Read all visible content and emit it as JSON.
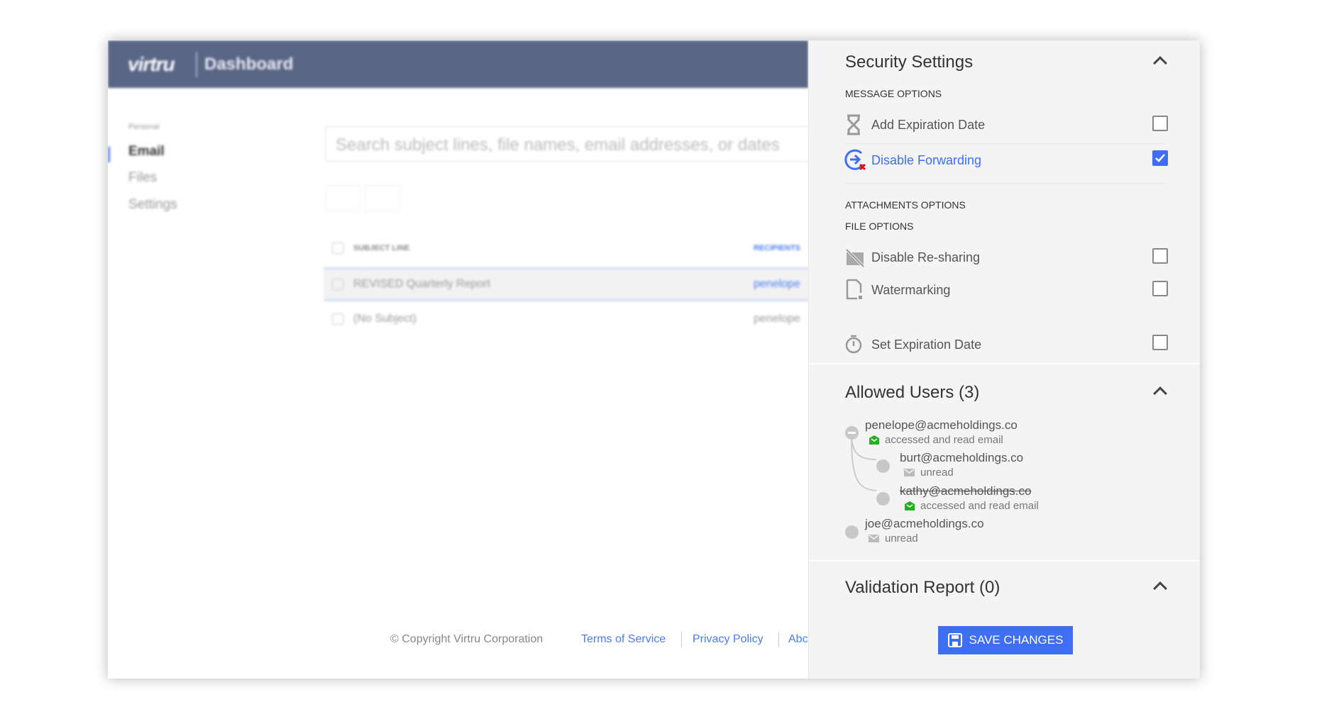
{
  "header": {
    "logo": "virtru",
    "title": "Dashboard"
  },
  "sidebar": {
    "section": "Personal",
    "items": [
      {
        "label": "Email",
        "active": true
      },
      {
        "label": "Files"
      },
      {
        "label": "Settings"
      }
    ]
  },
  "search": {
    "placeholder": "Search subject lines, file names, email addresses, or dates"
  },
  "table": {
    "columns": [
      "SUBJECT LINE",
      "RECIPIENTS"
    ],
    "rows": [
      {
        "subject": "REVISED Quarterly Report",
        "recipient": "penelope",
        "selected": true
      },
      {
        "subject": "(No Subject)",
        "recipient": "penelope"
      }
    ]
  },
  "footer": {
    "copyright": "© Copyright Virtru Corporation",
    "links": [
      "Terms of Service",
      "Privacy Policy",
      "Abc"
    ]
  },
  "panel": {
    "security": {
      "title": "Security Settings",
      "message_options": "MESSAGE OPTIONS",
      "attachments_options": "ATTACHMENTS OPTIONS",
      "file_options": "FILE OPTIONS",
      "options": [
        {
          "label": "Add Expiration Date",
          "icon": "hourglass-icon",
          "checked": false
        },
        {
          "label": "Disable Forwarding",
          "icon": "disable-forward-icon",
          "checked": true
        },
        {
          "label": "Disable Re-sharing",
          "icon": "no-share-icon",
          "checked": false
        },
        {
          "label": "Watermarking",
          "icon": "watermark-file-icon",
          "checked": false
        },
        {
          "label": "Set Expiration Date",
          "icon": "stopwatch-icon",
          "checked": false
        }
      ]
    },
    "allowed_users": {
      "title": "Allowed Users (3)",
      "users": [
        {
          "email": "penelope@acmeholdings.co",
          "status": "accessed and read email"
        },
        {
          "email": "burt@acmeholdings.co",
          "status": "unread"
        },
        {
          "email": "kathy@acmeholdings.co",
          "status": "accessed and read email",
          "revoked": true
        },
        {
          "email": "joe@acmeholdings.co",
          "status": "unread"
        }
      ]
    },
    "validation": {
      "title": "Validation Report (0)"
    },
    "save_label": "SAVE CHANGES"
  },
  "colors": {
    "header": "#5a6686",
    "accent": "#3d6ef5",
    "read": "#22b022",
    "panel": "#f4f4f4"
  }
}
